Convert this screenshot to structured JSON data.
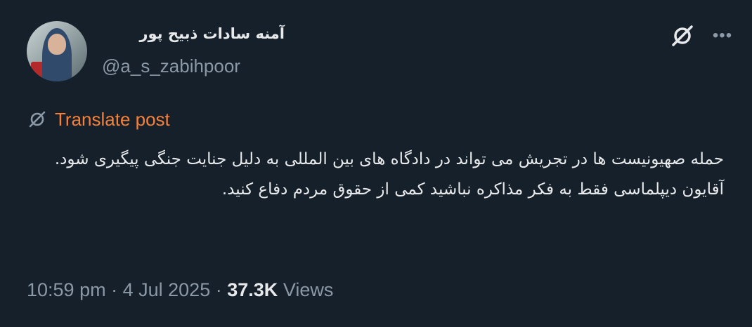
{
  "post": {
    "author_name": "آمنه سادات ذبیح پور",
    "author_handle": "@a_s_zabihpoor",
    "translate_label": "Translate post",
    "text_lines": [
      "حمله  صهیونیست ها در تجریش می تواند در دادگاه های بین المللی به دلیل جنایت جنگی پیگیری شود.",
      "آقایون دیپلماسی فقط به فکر مذاکره نباشید کمی از حقوق مردم دفاع کنید."
    ],
    "time": "10:59 pm",
    "separator": "·",
    "date": "4 Jul 2025",
    "views_count": "37.3K",
    "views_label": "Views"
  },
  "icons": {
    "grok": "grok-icon",
    "more": "more-icon",
    "translate": "translate-icon"
  },
  "colors": {
    "background": "#15202b",
    "text": "#e7e9ea",
    "muted": "#8b98a5",
    "accent": "#f4803a"
  }
}
